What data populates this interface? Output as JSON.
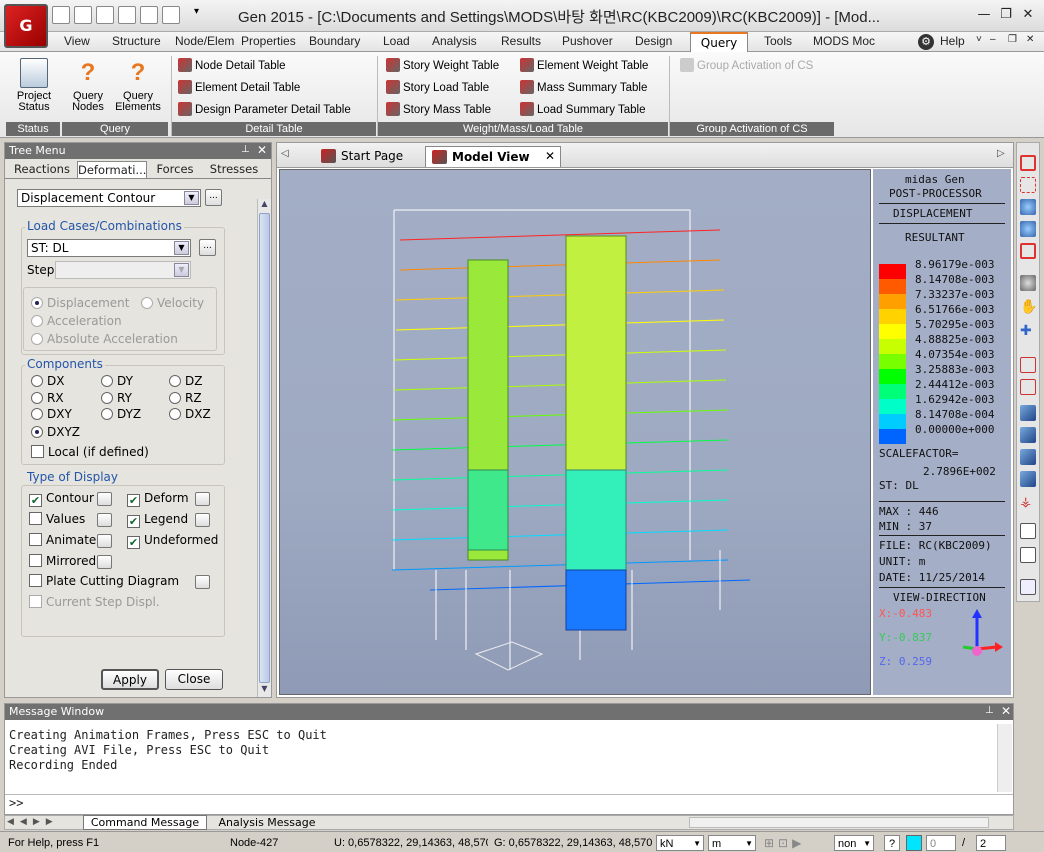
{
  "app": {
    "logo_text": "G",
    "title": "Gen 2015 - [C:\\Documents and Settings\\MODS\\바탕 화면\\RC(KBC2009)\\RC(KBC2009)] - [Mod...",
    "help_label": "Help"
  },
  "menu": [
    "View",
    "Structure",
    "Node/Elem",
    "Properties",
    "Boundary",
    "Load",
    "Analysis",
    "Results",
    "Pushover",
    "Design",
    "Query",
    "Tools",
    "MODS Moc"
  ],
  "menu_active": "Query",
  "ribbon": {
    "status_group": {
      "project_status": "Project\nStatus",
      "label": "Status"
    },
    "query_group": {
      "query_nodes": "Query\nNodes",
      "query_elements": "Query\nElements",
      "label": "Query"
    },
    "detail_group": {
      "items": [
        "Node Detail Table",
        "Element Detail Table",
        "Design Parameter Detail Table"
      ],
      "label": "Detail Table"
    },
    "wml_group": {
      "col1": [
        "Story Weight Table",
        "Story Load Table",
        "Story Mass Table"
      ],
      "col2": [
        "Element Weight Table",
        "Mass Summary Table",
        "Load Summary Table"
      ],
      "label": "Weight/Mass/Load Table"
    },
    "cs_group": {
      "item": "Group Activation of CS",
      "label": "Group Activation of CS"
    }
  },
  "tree": {
    "title": "Tree Menu",
    "tabs": [
      "Reactions",
      "Deformati...",
      "Forces",
      "Stresses"
    ],
    "display_type": "Displacement Contour",
    "load_cases_label": "Load Cases/Combinations",
    "load_case": "ST: DL",
    "step_label": "Step",
    "response": [
      "Displacement",
      "Velocity",
      "Acceleration",
      "Absolute Acceleration"
    ],
    "components_label": "Components",
    "components": [
      "DX",
      "DY",
      "DZ",
      "RX",
      "RY",
      "RZ",
      "DXY",
      "DYZ",
      "DXZ",
      "DXYZ"
    ],
    "components_selected": "DXYZ",
    "local_label": "Local (if defined)",
    "type_label": "Type of Display",
    "types": {
      "contour": "Contour",
      "deform": "Deform",
      "values": "Values",
      "legend": "Legend",
      "animate": "Animate",
      "undeformed": "Undeformed",
      "mirrored": "Mirrored",
      "plate": "Plate Cutting Diagram",
      "step": "Current Step Displ."
    },
    "apply": "Apply",
    "close": "Close"
  },
  "doc_tabs": [
    "Start Page",
    "Model View"
  ],
  "legend": {
    "header1": "midas Gen",
    "header2": "POST-PROCESSOR",
    "header3": "DISPLACEMENT",
    "header4": "RESULTANT",
    "values": [
      "8.96179e-003",
      "8.14708e-003",
      "7.33237e-003",
      "6.51766e-003",
      "5.70295e-003",
      "4.88825e-003",
      "4.07354e-003",
      "3.25883e-003",
      "2.44412e-003",
      "1.62942e-003",
      "8.14708e-004",
      "0.00000e+000"
    ],
    "colors": [
      "#ff0000",
      "#ff5a00",
      "#ffa000",
      "#ffd200",
      "#ffff00",
      "#c8ff00",
      "#78ff00",
      "#00ff00",
      "#00ff78",
      "#00ffc8",
      "#00ccff",
      "#0064ff"
    ],
    "scale_label": "SCALEFACTOR=",
    "scale_value": "2.7896E+002",
    "st": "ST: DL",
    "max": "MAX : 446",
    "min": "MIN : 37",
    "file": "FILE: RC(KBC2009)",
    "unit": "UNIT: m",
    "date": "DATE: 11/25/2014",
    "view_dir": "VIEW-DIRECTION",
    "vx": "X:-0.483",
    "vy": "Y:-0.837",
    "vz": "Z: 0.259"
  },
  "messages": {
    "title": "Message Window",
    "lines": [
      "Creating Animation Frames, Press ESC to Quit",
      "Creating AVI File, Press ESC to Quit",
      "Recording Ended"
    ],
    "prompt": ">>",
    "tabs": [
      "Command Message",
      "Analysis Message"
    ]
  },
  "status": {
    "help": "For Help, press F1",
    "node": "Node-427",
    "u": "U: 0,6578322, 29,14363, 48,570",
    "g": "G: 0,6578322, 29,14363, 48,570",
    "force_unit": "kN",
    "length_unit": "m",
    "snap": "non",
    "query": "?",
    "frame": "0",
    "total": "2"
  }
}
